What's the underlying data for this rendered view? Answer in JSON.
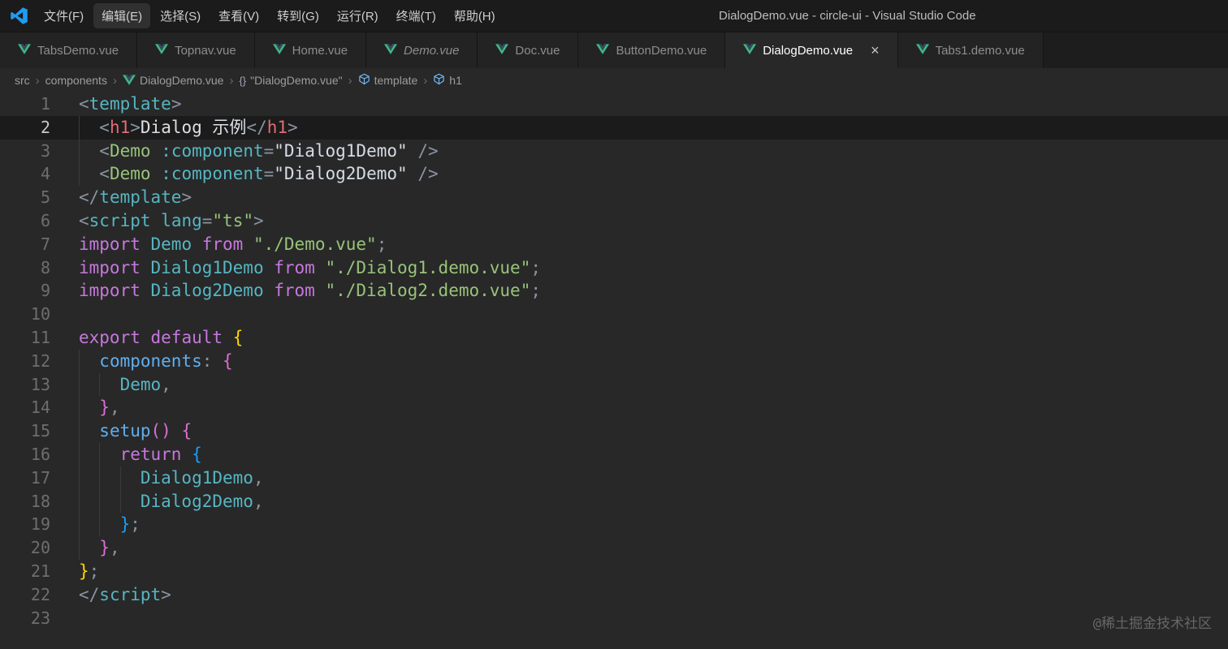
{
  "window": {
    "title": "DialogDemo.vue - circle-ui - Visual Studio Code"
  },
  "menu": {
    "items": [
      {
        "key": "file",
        "label": "文件(F)",
        "highlighted": false
      },
      {
        "key": "edit",
        "label": "编辑(E)",
        "highlighted": true
      },
      {
        "key": "selection",
        "label": "选择(S)",
        "highlighted": false
      },
      {
        "key": "view",
        "label": "查看(V)",
        "highlighted": false
      },
      {
        "key": "go",
        "label": "转到(G)",
        "highlighted": false
      },
      {
        "key": "run",
        "label": "运行(R)",
        "highlighted": false
      },
      {
        "key": "terminal",
        "label": "终端(T)",
        "highlighted": false
      },
      {
        "key": "help",
        "label": "帮助(H)",
        "highlighted": false
      }
    ]
  },
  "tabs": [
    {
      "label": "TabsDemo.vue",
      "active": false,
      "preview": false,
      "close": false
    },
    {
      "label": "Topnav.vue",
      "active": false,
      "preview": false,
      "close": false
    },
    {
      "label": "Home.vue",
      "active": false,
      "preview": false,
      "close": false
    },
    {
      "label": "Demo.vue",
      "active": false,
      "preview": true,
      "close": false
    },
    {
      "label": "Doc.vue",
      "active": false,
      "preview": false,
      "close": false
    },
    {
      "label": "ButtonDemo.vue",
      "active": false,
      "preview": false,
      "close": false
    },
    {
      "label": "DialogDemo.vue",
      "active": true,
      "preview": false,
      "close": true
    },
    {
      "label": "Tabs1.demo.vue",
      "active": false,
      "preview": false,
      "close": false
    }
  ],
  "breadcrumb": [
    {
      "key": "src",
      "label": "src",
      "icon": "none"
    },
    {
      "key": "components",
      "label": "components",
      "icon": "none"
    },
    {
      "key": "dialogdemo-file",
      "label": "DialogDemo.vue",
      "icon": "vue"
    },
    {
      "key": "module",
      "label": "\"DialogDemo.vue\"",
      "icon": "braces"
    },
    {
      "key": "template",
      "label": "template",
      "icon": "symbol"
    },
    {
      "key": "h1",
      "label": "h1",
      "icon": "symbol"
    }
  ],
  "editor": {
    "active_line": 2,
    "lines": [
      {
        "num": 1,
        "indent": 0,
        "tokens": [
          [
            "<",
            "pun"
          ],
          [
            "template",
            "tagc"
          ],
          [
            ">",
            "pun"
          ]
        ]
      },
      {
        "num": 2,
        "indent": 2,
        "tokens": [
          [
            "<",
            "pun"
          ],
          [
            "h1",
            "tagr"
          ],
          [
            ">",
            "pun"
          ],
          [
            "Dialog 示例",
            "txt"
          ],
          [
            "</",
            "pun"
          ],
          [
            "h1",
            "tagr"
          ],
          [
            ">",
            "pun"
          ]
        ]
      },
      {
        "num": 3,
        "indent": 2,
        "tokens": [
          [
            "<",
            "pun"
          ],
          [
            "Demo",
            "tagg"
          ],
          [
            " ",
            "pln"
          ],
          [
            ":component",
            "attr"
          ],
          [
            "=",
            "pun"
          ],
          [
            "\"Dialog1Demo\"",
            "val"
          ],
          [
            " ",
            "pln"
          ],
          [
            "/>",
            "pun"
          ]
        ]
      },
      {
        "num": 4,
        "indent": 2,
        "tokens": [
          [
            "<",
            "pun"
          ],
          [
            "Demo",
            "tagg"
          ],
          [
            " ",
            "pln"
          ],
          [
            ":component",
            "attr"
          ],
          [
            "=",
            "pun"
          ],
          [
            "\"Dialog2Demo\"",
            "val"
          ],
          [
            " ",
            "pln"
          ],
          [
            "/>",
            "pun"
          ]
        ]
      },
      {
        "num": 5,
        "indent": 0,
        "tokens": [
          [
            "</",
            "pun"
          ],
          [
            "template",
            "tagc"
          ],
          [
            ">",
            "pun"
          ]
        ]
      },
      {
        "num": 6,
        "indent": 0,
        "tokens": [
          [
            "<",
            "pun"
          ],
          [
            "script",
            "tagc"
          ],
          [
            " ",
            "pln"
          ],
          [
            "lang",
            "attr"
          ],
          [
            "=",
            "pun"
          ],
          [
            "\"ts\"",
            "str"
          ],
          [
            ">",
            "pun"
          ]
        ]
      },
      {
        "num": 7,
        "indent": 0,
        "tokens": [
          [
            "import",
            "kw"
          ],
          [
            " ",
            "pln"
          ],
          [
            "Demo",
            "id"
          ],
          [
            " ",
            "pln"
          ],
          [
            "from",
            "kw"
          ],
          [
            " ",
            "pln"
          ],
          [
            "\"./Demo.vue\"",
            "str"
          ],
          [
            ";",
            "pun"
          ]
        ]
      },
      {
        "num": 8,
        "indent": 0,
        "tokens": [
          [
            "import",
            "kw"
          ],
          [
            " ",
            "pln"
          ],
          [
            "Dialog1Demo",
            "id"
          ],
          [
            " ",
            "pln"
          ],
          [
            "from",
            "kw"
          ],
          [
            " ",
            "pln"
          ],
          [
            "\"./Dialog1.demo.vue\"",
            "str"
          ],
          [
            ";",
            "pun"
          ]
        ]
      },
      {
        "num": 9,
        "indent": 0,
        "tokens": [
          [
            "import",
            "kw"
          ],
          [
            " ",
            "pln"
          ],
          [
            "Dialog2Demo",
            "id"
          ],
          [
            " ",
            "pln"
          ],
          [
            "from",
            "kw"
          ],
          [
            " ",
            "pln"
          ],
          [
            "\"./Dialog2.demo.vue\"",
            "str"
          ],
          [
            ";",
            "pun"
          ]
        ]
      },
      {
        "num": 10,
        "indent": 0,
        "tokens": []
      },
      {
        "num": 11,
        "indent": 0,
        "tokens": [
          [
            "export",
            "kw"
          ],
          [
            " ",
            "pln"
          ],
          [
            "default",
            "kw"
          ],
          [
            " ",
            "pln"
          ],
          [
            "{",
            "b1"
          ]
        ]
      },
      {
        "num": 12,
        "indent": 2,
        "tokens": [
          [
            "components",
            "prop"
          ],
          [
            ":",
            "pun"
          ],
          [
            " ",
            "pln"
          ],
          [
            "{",
            "b2"
          ]
        ]
      },
      {
        "num": 13,
        "indent": 4,
        "tokens": [
          [
            "Demo",
            "id"
          ],
          [
            ",",
            "pun"
          ]
        ]
      },
      {
        "num": 14,
        "indent": 2,
        "tokens": [
          [
            "}",
            "b2"
          ],
          [
            ",",
            "pun"
          ]
        ]
      },
      {
        "num": 15,
        "indent": 2,
        "tokens": [
          [
            "setup",
            "fn"
          ],
          [
            "(",
            "b2"
          ],
          [
            ")",
            "b2"
          ],
          [
            " ",
            "pln"
          ],
          [
            "{",
            "b2"
          ]
        ]
      },
      {
        "num": 16,
        "indent": 4,
        "tokens": [
          [
            "return",
            "kw"
          ],
          [
            " ",
            "pln"
          ],
          [
            "{",
            "b3"
          ]
        ]
      },
      {
        "num": 17,
        "indent": 6,
        "tokens": [
          [
            "Dialog1Demo",
            "id"
          ],
          [
            ",",
            "pun"
          ]
        ]
      },
      {
        "num": 18,
        "indent": 6,
        "tokens": [
          [
            "Dialog2Demo",
            "id"
          ],
          [
            ",",
            "pun"
          ]
        ]
      },
      {
        "num": 19,
        "indent": 4,
        "tokens": [
          [
            "}",
            "b3"
          ],
          [
            ";",
            "pun"
          ]
        ]
      },
      {
        "num": 20,
        "indent": 2,
        "tokens": [
          [
            "}",
            "b2"
          ],
          [
            ",",
            "pun"
          ]
        ]
      },
      {
        "num": 21,
        "indent": 0,
        "tokens": [
          [
            "}",
            "b1"
          ],
          [
            ";",
            "pun"
          ]
        ]
      },
      {
        "num": 22,
        "indent": 0,
        "tokens": [
          [
            "</",
            "pun"
          ],
          [
            "script",
            "tagc"
          ],
          [
            ">",
            "pun"
          ]
        ]
      },
      {
        "num": 23,
        "indent": 0,
        "tokens": []
      }
    ]
  },
  "watermark": "@稀土掘金技术社区",
  "colors": {
    "vue_green": "#41b883",
    "vue_navy": "#35495e",
    "vscode_blue": "#1f9cf0",
    "symbol_blue": "#75beff",
    "bracket_gold": "#ffd700",
    "bracket_orchid": "#da70d6",
    "bracket_blue": "#179fff"
  }
}
